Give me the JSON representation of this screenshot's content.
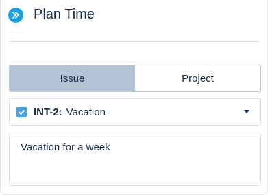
{
  "header": {
    "title": "Plan Time",
    "collapse_icon": "double-chevron-right-icon",
    "icon_color": "#1ba1e2"
  },
  "toggle": {
    "options": [
      {
        "label": "Issue",
        "active": true
      },
      {
        "label": "Project",
        "active": false
      }
    ],
    "active_color": "#b3c3d4"
  },
  "issue_select": {
    "checked": true,
    "key": "INT-2:",
    "summary": "Vacation",
    "checkbox_color": "#4aa3df"
  },
  "description": {
    "value": "Vacation for a week"
  }
}
